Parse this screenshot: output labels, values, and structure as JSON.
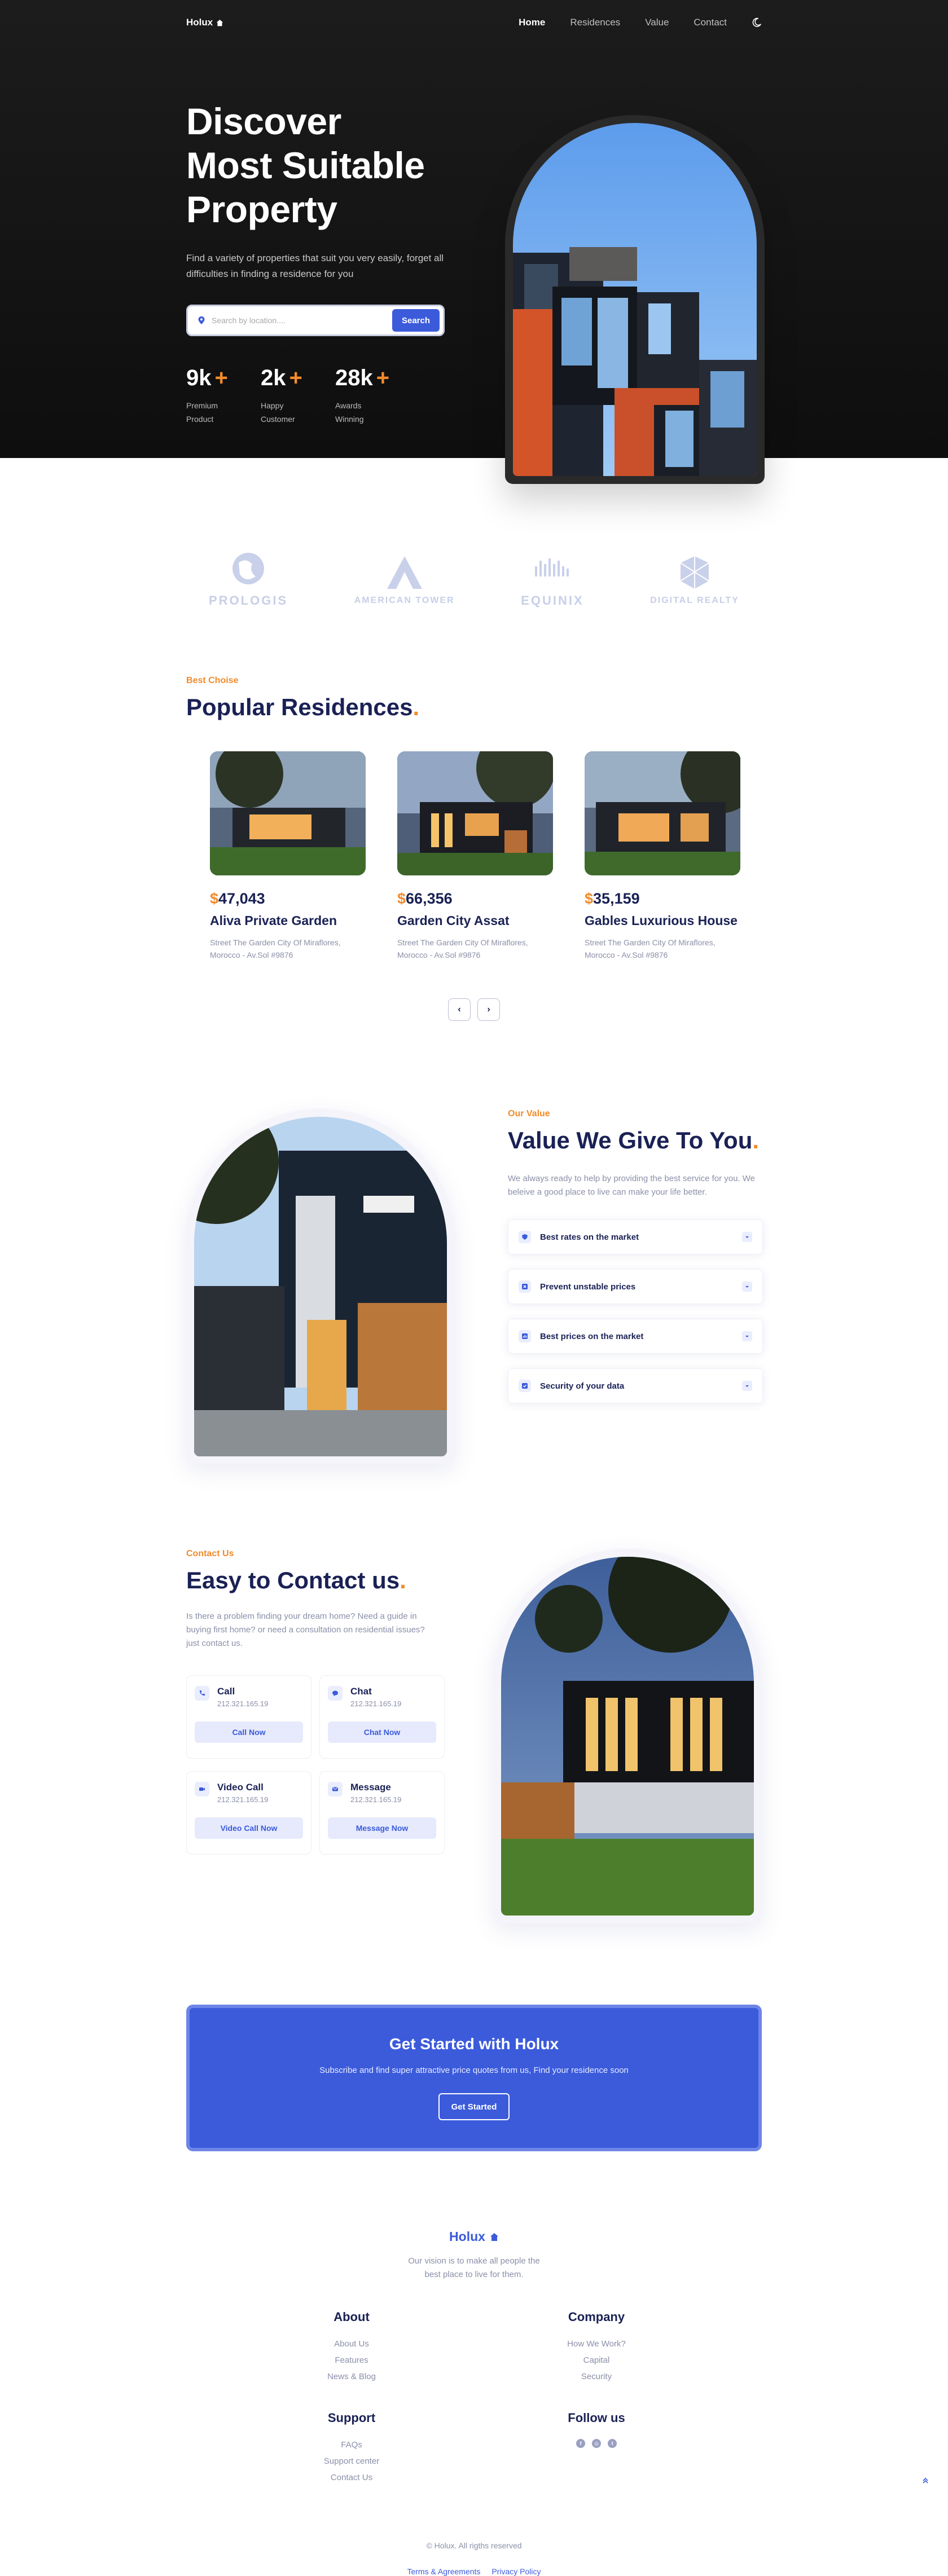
{
  "nav": {
    "logo": "Holux",
    "items": [
      "Home",
      "Residences",
      "Value",
      "Contact"
    ]
  },
  "hero": {
    "title_line1": "Discover",
    "title_line2": "Most Suitable",
    "title_line3": "Property",
    "subtitle": "Find a variety of properties that suit you very easily, forget all difficulties in finding a residence for you",
    "search_placeholder": "Search by location....",
    "search_button": "Search",
    "stats": [
      {
        "num": "9k",
        "plus": "+",
        "label": "Premium Product"
      },
      {
        "num": "2k",
        "plus": "+",
        "label": "Happy Customer"
      },
      {
        "num": "28k",
        "plus": "+",
        "label": "Awards Winning"
      }
    ]
  },
  "partners": [
    "PROLOGIS",
    "AMERICAN TOWER",
    "EQUINIX",
    "DIGITAL REALTY"
  ],
  "residences": {
    "eyebrow": "Best Choise",
    "title": "Popular Residences",
    "title_dot": ".",
    "cards": [
      {
        "currency": "$",
        "price": "47,043",
        "name": "Aliva Private Garden",
        "address": "Street The Garden City Of Miraflores, Morocco - Av.Sol #9876"
      },
      {
        "currency": "$",
        "price": "66,356",
        "name": "Garden City Assat",
        "address": "Street The Garden City Of Miraflores, Morocco - Av.Sol #9876"
      },
      {
        "currency": "$",
        "price": "35,159",
        "name": "Gables Luxurious House",
        "address": "Street The Garden City Of Miraflores, Morocco - Av.Sol #9876"
      }
    ],
    "prev": "‹",
    "next": "›"
  },
  "value": {
    "eyebrow": "Our Value",
    "title": "Value We Give To You",
    "title_dot": ".",
    "subtitle": "We always ready to help by providing the best service for you. We beleive a good place to live can make your life better.",
    "items": [
      "Best rates on the market",
      "Prevent unstable prices",
      "Best prices on the market",
      "Security of your data"
    ]
  },
  "contact": {
    "eyebrow": "Contact Us",
    "title": "Easy to Contact us",
    "title_dot": ".",
    "subtitle": "Is there a problem finding your dream home? Need a guide in buying first home? or need a consultation on residential issues? just contact us.",
    "tiles": [
      {
        "name": "Call",
        "phone": "212.321.165.19",
        "button": "Call Now"
      },
      {
        "name": "Chat",
        "phone": "212.321.165.19",
        "button": "Chat Now"
      },
      {
        "name": "Video Call",
        "phone": "212.321.165.19",
        "button": "Video Call Now"
      },
      {
        "name": "Message",
        "phone": "212.321.165.19",
        "button": "Message Now"
      }
    ]
  },
  "cta": {
    "title": "Get Started with Holux",
    "subtitle": "Subscribe and find super attractive price quotes from us, Find your residence soon",
    "button": "Get Started"
  },
  "footer": {
    "logo": "Holux",
    "vision": "Our vision is to make all people the best place to live for them.",
    "about": {
      "title": "About",
      "links": [
        "About Us",
        "Features",
        "News & Blog"
      ]
    },
    "company": {
      "title": "Company",
      "links": [
        "How We Work?",
        "Capital",
        "Security"
      ]
    },
    "support": {
      "title": "Support",
      "links": [
        "FAQs",
        "Support center",
        "Contact Us"
      ]
    },
    "follow": {
      "title": "Follow us"
    },
    "copyright": "© Holux. All rigths reserved",
    "terms": "Terms & Agreements",
    "privacy": "Privacy Policy"
  },
  "colors": {
    "accent": "#3b5bdb",
    "orange": "#f28b2c",
    "navy": "#1a2155",
    "hero_bg": "#151515"
  }
}
